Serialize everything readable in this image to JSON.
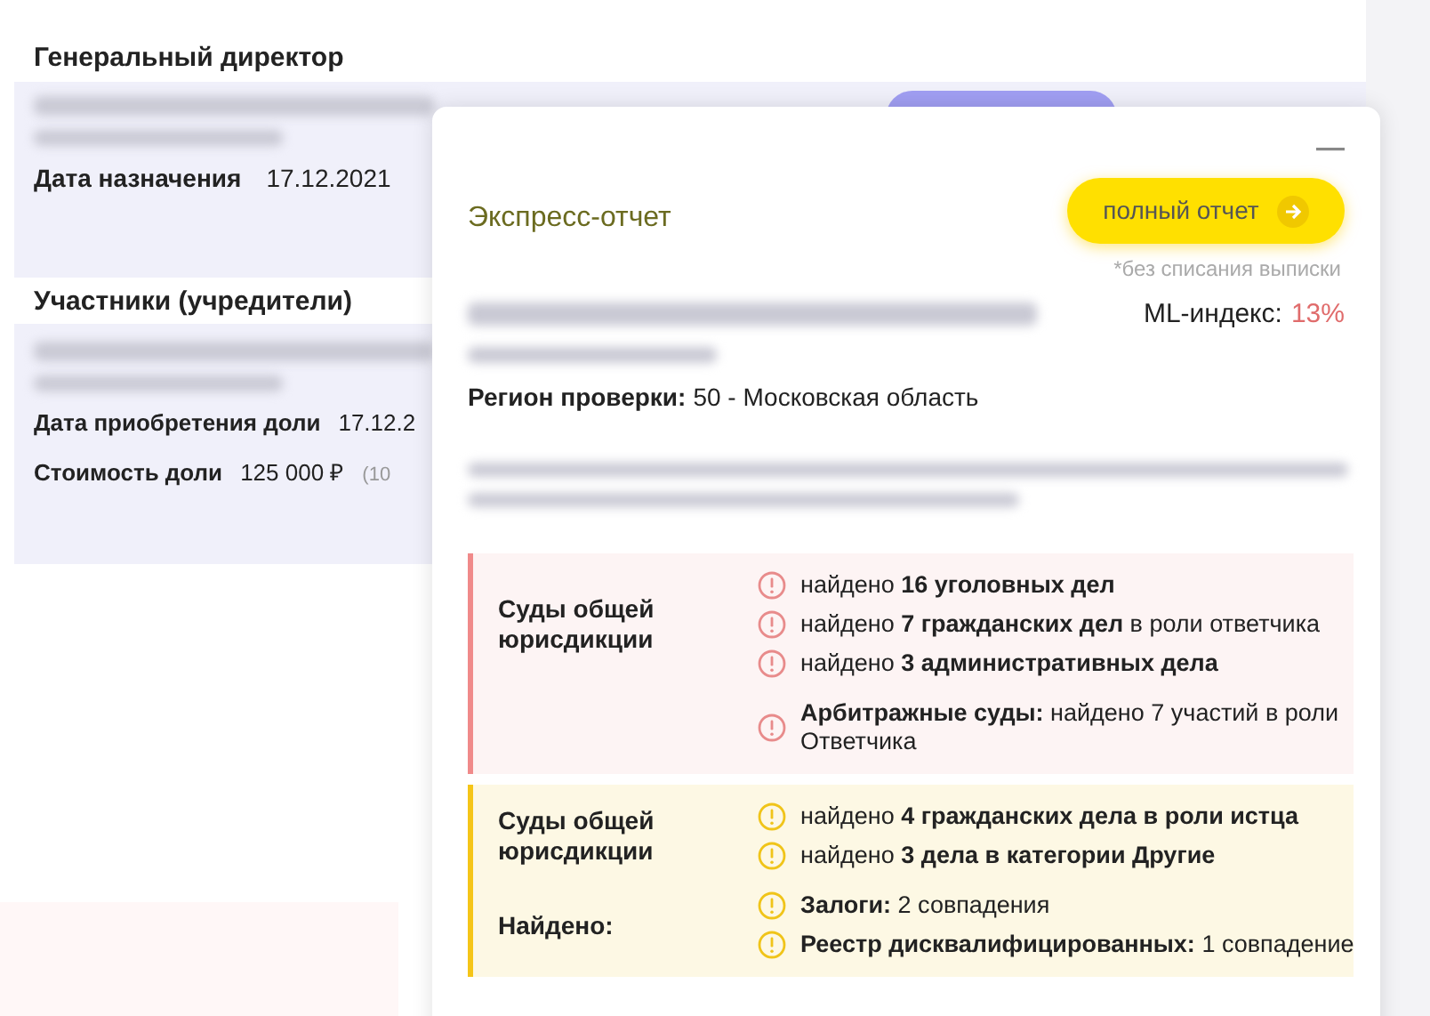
{
  "page": {
    "director": {
      "heading": "Генеральный директор",
      "fields": [
        {
          "label": "Дата назначения",
          "value": "17.12.2021"
        }
      ]
    },
    "founders": {
      "heading": "Участники (учредители)",
      "fields": [
        {
          "label": "Дата приобретения доли",
          "value": "17.12.2"
        },
        {
          "label": "Стоимость доли",
          "value": "125 000 ₽",
          "note": "(10"
        }
      ]
    }
  },
  "report": {
    "title": "Экспресс-отчет",
    "button": "полный отчет",
    "button_note": "*без списания выписки",
    "ml_label": "ML-индекс:",
    "ml_value": "13%",
    "region_label": "Регион проверки:",
    "region_value": "50 - Московская область",
    "sections": [
      {
        "kind": "danger",
        "groups": [
          {
            "label": "Суды общей юрисдикции",
            "items": [
              "найдено **16 уголовных дел**",
              "найдено **7 гражданских дел** в роли ответчика",
              "найдено **3 административных дела**"
            ]
          },
          {
            "items": [
              "**Арбитражные суды:** найдено 7 участий в роли Ответчика"
            ]
          }
        ]
      },
      {
        "kind": "warning",
        "groups": [
          {
            "label": "Суды общей юрисдикции",
            "items": [
              "найдено **4 гражданских дела в роли истца**",
              "найдено **3 дела в категории Другие**"
            ]
          },
          {
            "label": "Найдено:",
            "items": [
              "**Залоги:** 2 совпадения",
              "**Реестр дисквалифицированных:** 1 совпадение"
            ]
          }
        ]
      }
    ]
  }
}
